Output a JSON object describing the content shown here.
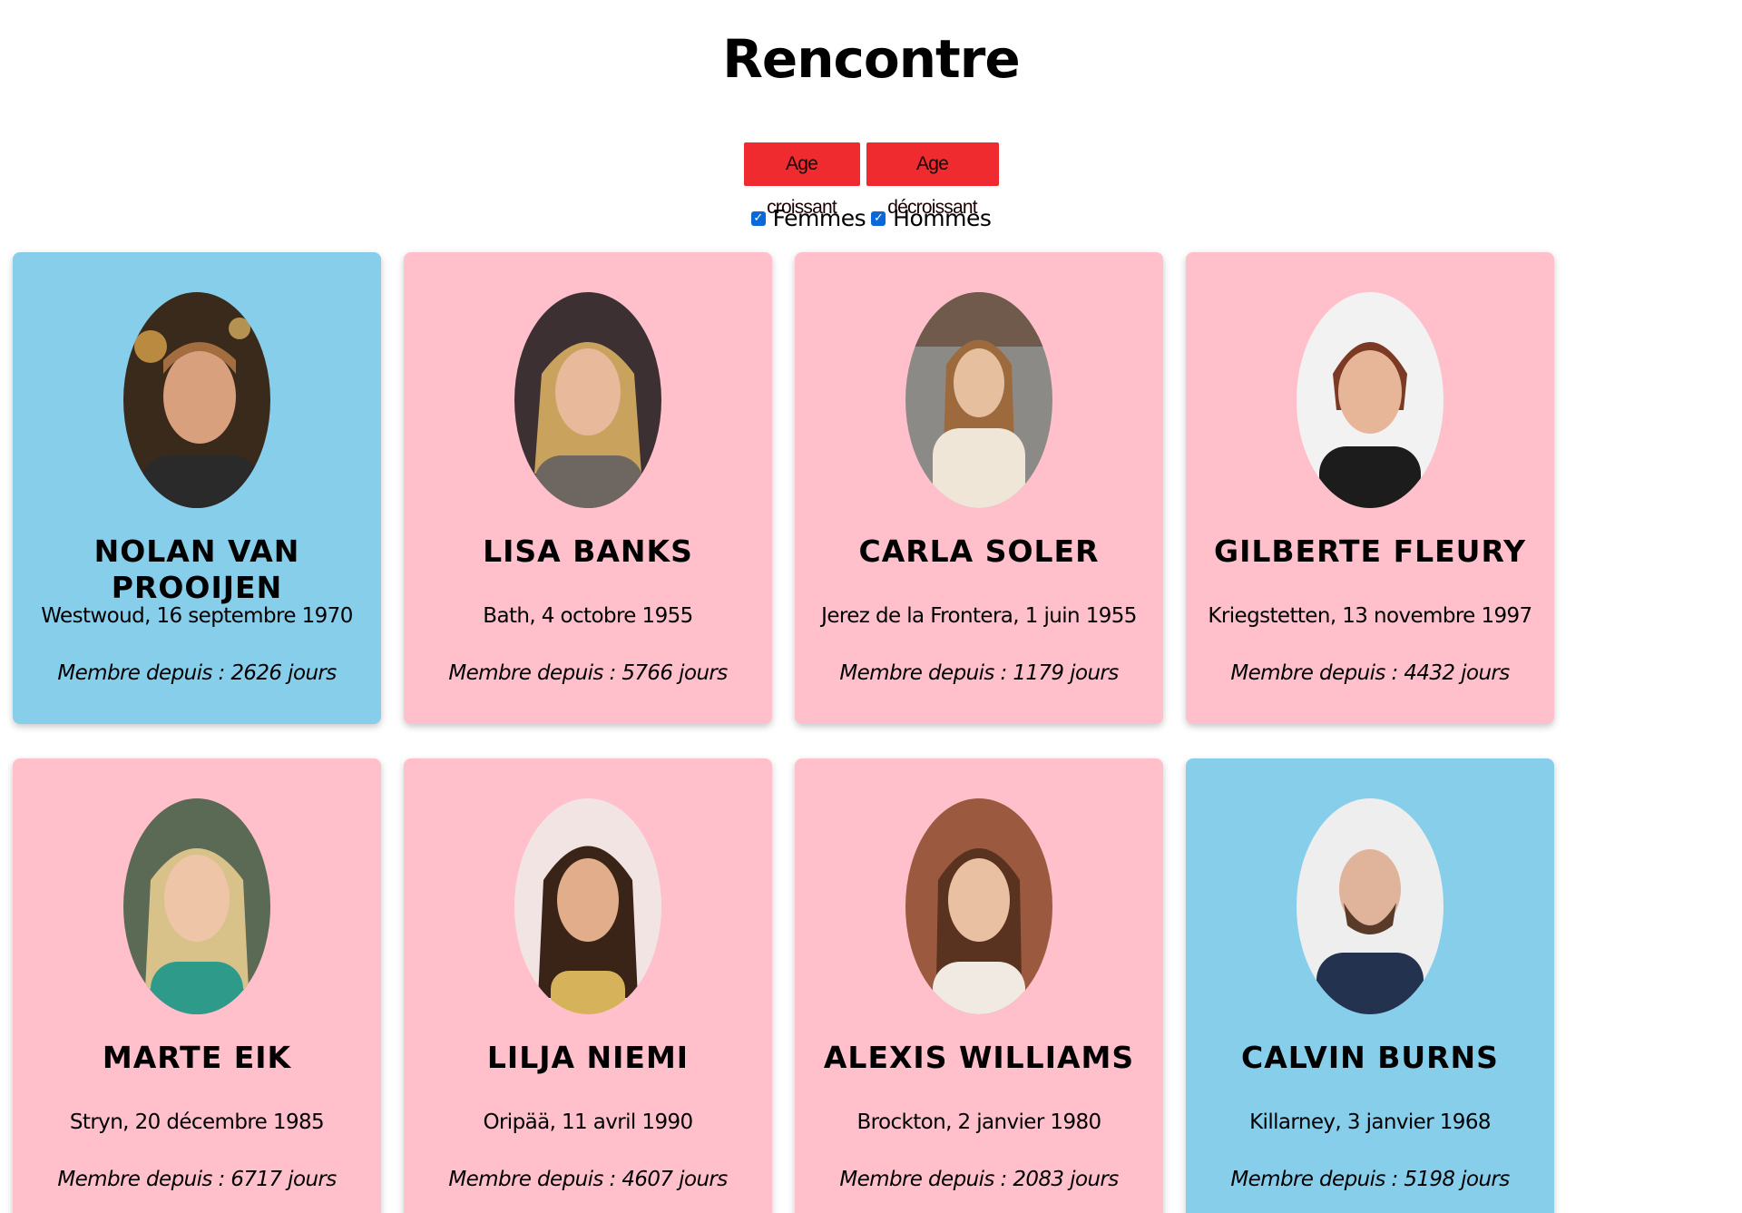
{
  "page": {
    "title": "Rencontre"
  },
  "sort": {
    "ascending_label": "Age croissant",
    "descending_label": "Age décroissant"
  },
  "filters": {
    "women_label": "Femmes",
    "women_checked": true,
    "men_label": "Hommes",
    "men_checked": true
  },
  "colors": {
    "male_card": "#87ceeb",
    "female_card": "#ffc0cb",
    "sort_button": "#ef2b2f"
  },
  "members": [
    {
      "name": "NOLAN VAN PROOIJEN",
      "origin": "Westwoud, 16 septembre 1970",
      "member_since": "Membre depuis : 2626 jours",
      "gender": "male",
      "photo_icon": "profile-photo-icon"
    },
    {
      "name": "LISA BANKS",
      "origin": "Bath, 4 octobre 1955",
      "member_since": "Membre depuis : 5766 jours",
      "gender": "female",
      "photo_icon": "profile-photo-icon"
    },
    {
      "name": "CARLA SOLER",
      "origin": "Jerez de la Frontera, 1 juin 1955",
      "member_since": "Membre depuis : 1179 jours",
      "gender": "female",
      "photo_icon": "profile-photo-icon"
    },
    {
      "name": "GILBERTE FLEURY",
      "origin": "Kriegstetten, 13 novembre 1997",
      "member_since": "Membre depuis : 4432 jours",
      "gender": "female",
      "photo_icon": "profile-photo-icon"
    },
    {
      "name": "MARTE EIK",
      "origin": "Stryn, 20 décembre 1985",
      "member_since": "Membre depuis : 6717 jours",
      "gender": "female",
      "photo_icon": "profile-photo-icon"
    },
    {
      "name": "LILJA NIEMI",
      "origin": "Oripää, 11 avril 1990",
      "member_since": "Membre depuis : 4607 jours",
      "gender": "female",
      "photo_icon": "profile-photo-icon"
    },
    {
      "name": "ALEXIS WILLIAMS",
      "origin": "Brockton, 2 janvier 1980",
      "member_since": "Membre depuis : 2083 jours",
      "gender": "female",
      "photo_icon": "profile-photo-icon"
    },
    {
      "name": "CALVIN BURNS",
      "origin": "Killarney, 3 janvier 1968",
      "member_since": "Membre depuis : 5198 jours",
      "gender": "male",
      "photo_icon": "profile-photo-icon"
    }
  ]
}
